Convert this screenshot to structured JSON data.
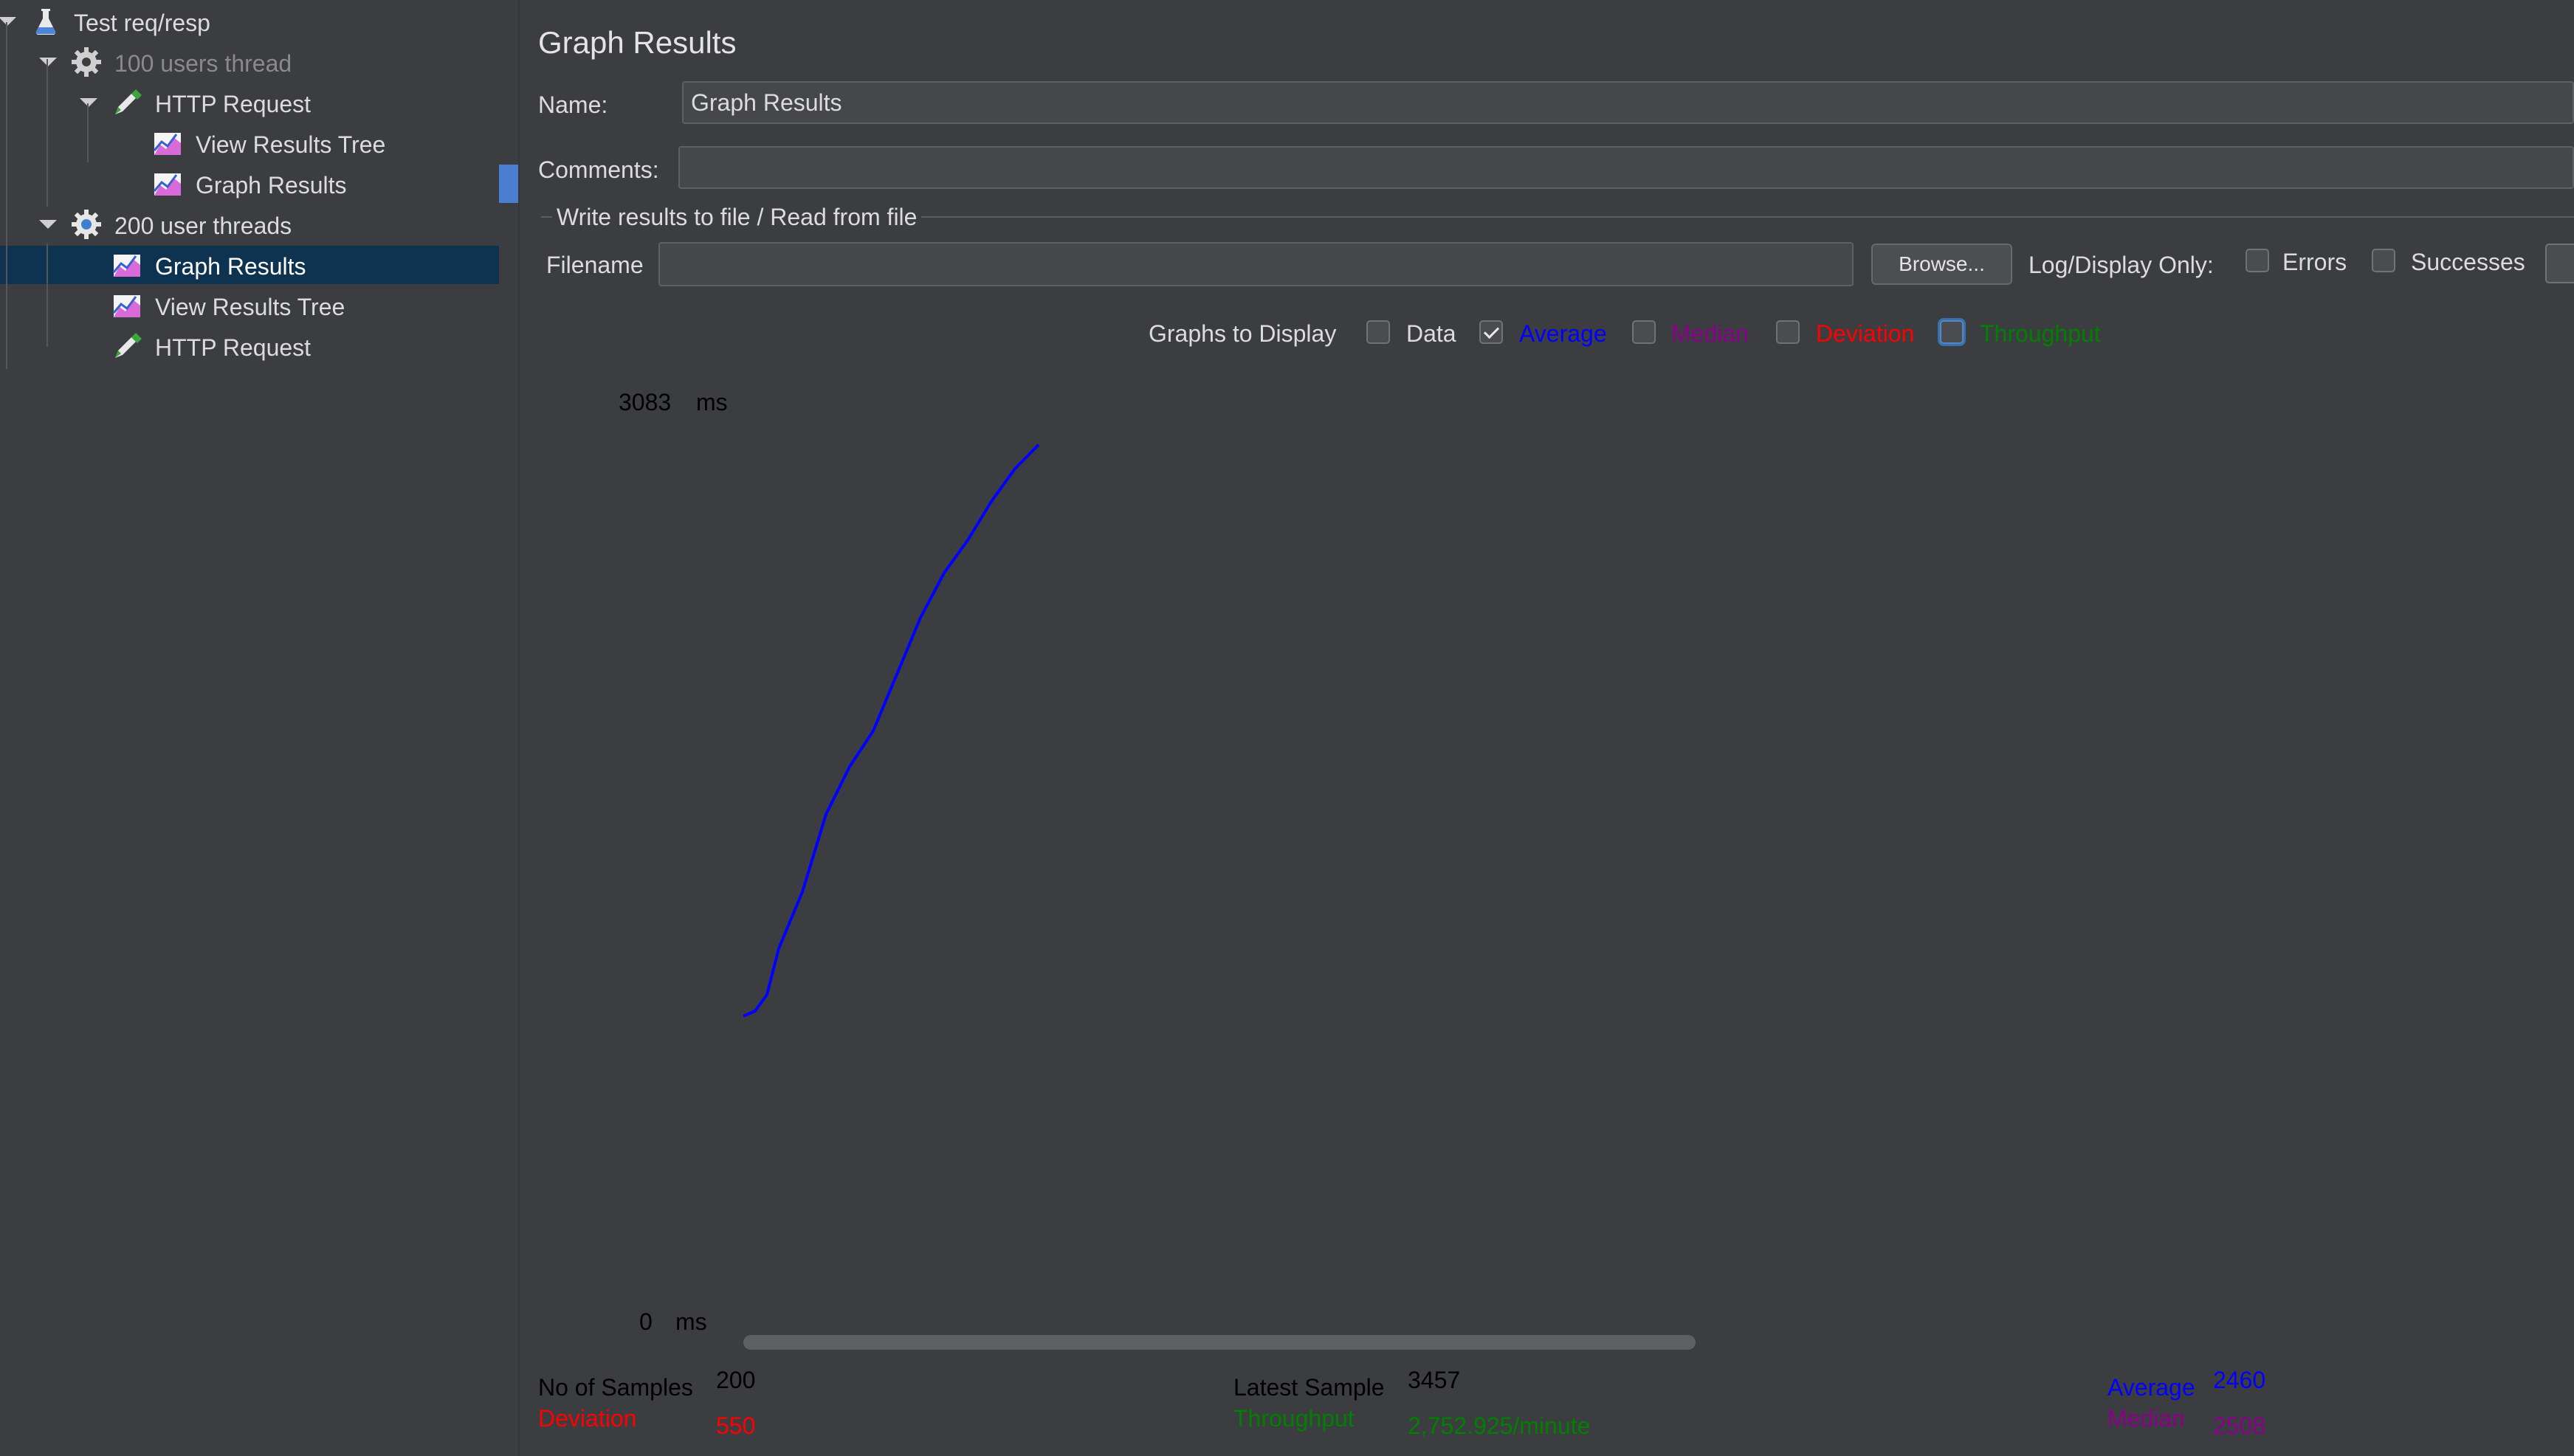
{
  "tree": {
    "items": [
      {
        "label": "Test req/resp",
        "icon": "flask-icon",
        "level": 0,
        "expanded": true
      },
      {
        "label": "100 users thread",
        "icon": "gear-icon",
        "level": 1,
        "expanded": true,
        "disabled": true
      },
      {
        "label": "HTTP Request",
        "icon": "pipette-icon",
        "level": 2,
        "expanded": true
      },
      {
        "label": "View Results Tree",
        "icon": "graph-icon",
        "level": 3
      },
      {
        "label": "Graph Results",
        "icon": "graph-icon",
        "level": 3
      },
      {
        "label": "200 user threads",
        "icon": "gear-icon",
        "level": 1,
        "expanded": true
      },
      {
        "label": "Graph Results",
        "icon": "graph-icon",
        "level": 2,
        "selected": true
      },
      {
        "label": "View Results Tree",
        "icon": "graph-icon",
        "level": 2
      },
      {
        "label": "HTTP Request",
        "icon": "pipette-icon",
        "level": 2
      }
    ]
  },
  "panel": {
    "title": "Graph Results",
    "name_label": "Name:",
    "name_value": "Graph Results",
    "comments_label": "Comments:",
    "comments_value": "",
    "file_section_title": "Write results to file / Read from file",
    "filename_label": "Filename",
    "filename_value": "",
    "browse_label": "Browse...",
    "log_display_label": "Log/Display Only:",
    "errors_label": "Errors",
    "successes_label": "Successes"
  },
  "graphs_to_display": {
    "label": "Graphs to Display",
    "options": [
      {
        "label": "Data",
        "checked": false,
        "color": "#dcdcdc"
      },
      {
        "label": "Average",
        "checked": true,
        "color": "#0000ff"
      },
      {
        "label": "Median",
        "checked": false,
        "color": "#8b008b"
      },
      {
        "label": "Deviation",
        "checked": false,
        "color": "#ff0000"
      },
      {
        "label": "Throughput",
        "checked": false,
        "color": "#008000",
        "focused": true
      }
    ]
  },
  "chart_data": {
    "type": "line",
    "y_max_label": "3083",
    "y_min_label": "0",
    "y_unit": "ms",
    "ylim": [
      0,
      3083
    ],
    "xlim": [
      0,
      800
    ],
    "series": [
      {
        "color": "#0000ff",
        "x": [
          0,
          8,
          16,
          24,
          40,
          56,
          72,
          88,
          104,
          120,
          136,
          152,
          168,
          184,
          200
        ],
        "y": [
          1023,
          1040,
          1095,
          1250,
          1440,
          1700,
          1860,
          1980,
          2170,
          2360,
          2510,
          2620,
          2750,
          2860,
          2940
        ]
      }
    ]
  },
  "stats": {
    "no_samples_label": "No of Samples",
    "no_samples_value": "200",
    "deviation_label": "Deviation",
    "deviation_value": "550",
    "latest_sample_label": "Latest Sample",
    "latest_sample_value": "3457",
    "throughput_label": "Throughput",
    "throughput_value": "2,752.925/minute",
    "average_label": "Average",
    "average_value": "2460",
    "median_label": "Median",
    "median_value": "2508",
    "colors": {
      "black": "#000000",
      "deviation": "#ff0000",
      "throughput": "#008000",
      "average": "#0000ff",
      "median": "#8b008b"
    }
  }
}
